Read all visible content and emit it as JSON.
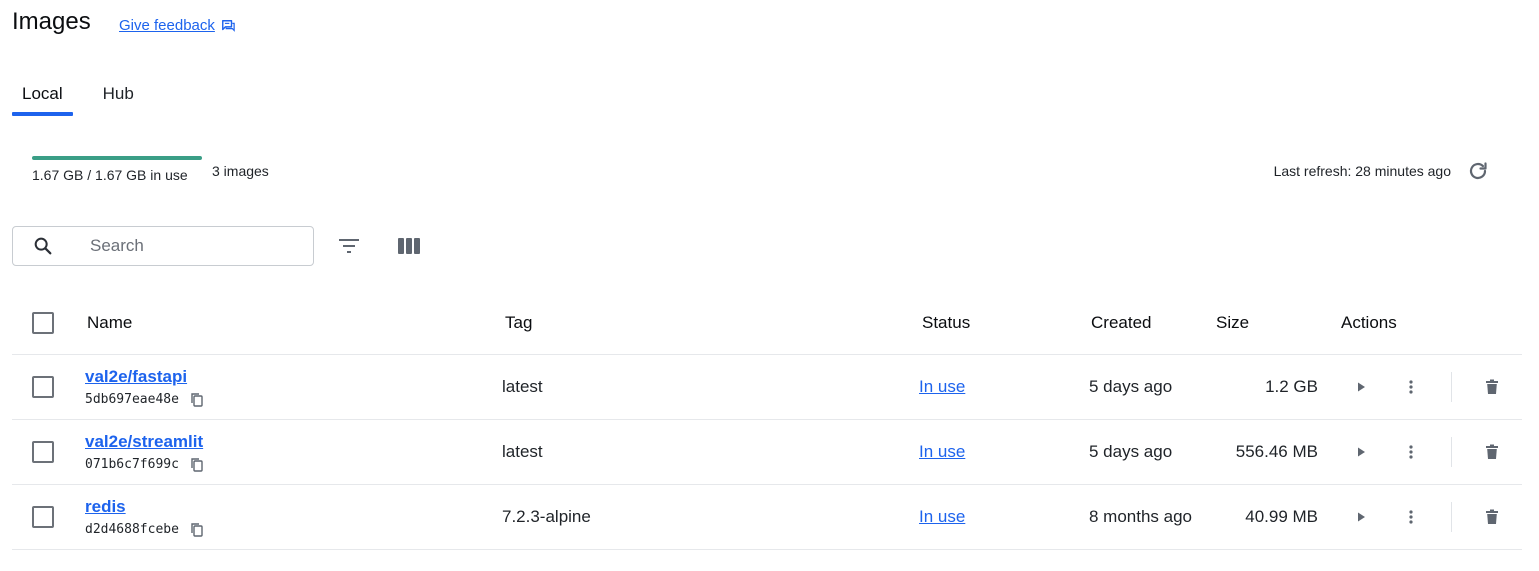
{
  "header": {
    "title": "Images",
    "feedback_label": "Give feedback"
  },
  "tabs": [
    {
      "label": "Local",
      "active": true
    },
    {
      "label": "Hub",
      "active": false
    }
  ],
  "usage": {
    "text": "1.67 GB / 1.67 GB in use",
    "fraction": 1.0,
    "count_text": "3 images",
    "last_refresh": "Last refresh: 28 minutes ago"
  },
  "search": {
    "placeholder": "Search",
    "value": ""
  },
  "table": {
    "columns": {
      "name": "Name",
      "tag": "Tag",
      "status": "Status",
      "created": "Created",
      "size": "Size",
      "actions": "Actions"
    },
    "rows": [
      {
        "name": "val2e/fastapi",
        "id": "5db697eae48e",
        "tag": "latest",
        "status": "In use",
        "created": "5 days ago",
        "size": "1.2 GB"
      },
      {
        "name": "val2e/streamlit",
        "id": "071b6c7f699c",
        "tag": "latest",
        "status": "In use",
        "created": "5 days ago",
        "size": "556.46 MB"
      },
      {
        "name": "redis",
        "id": "d2d4688fcebe",
        "tag": "7.2.3-alpine",
        "status": "In use",
        "created": "8 months ago",
        "size": "40.99 MB"
      }
    ]
  },
  "colors": {
    "accent": "#1d63ed",
    "usage_fill": "#3a9e86",
    "icon": "#5f6670"
  },
  "icons": {
    "feedback": "feedback-icon",
    "refresh": "refresh-icon",
    "search": "search-icon",
    "filter": "filter-icon",
    "columns": "columns-icon",
    "copy": "copy-icon",
    "run": "play-icon",
    "more": "more-vertical-icon",
    "delete": "trash-icon"
  }
}
